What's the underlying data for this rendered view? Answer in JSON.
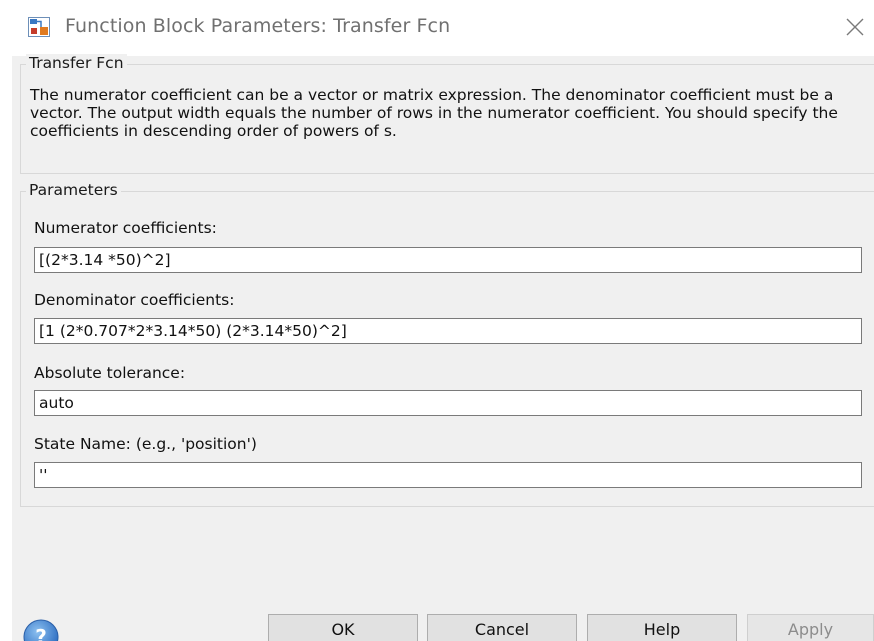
{
  "window": {
    "title": "Function Block Parameters: Transfer Fcn"
  },
  "block": {
    "name": "Transfer Fcn",
    "description": "The numerator coefficient can be a vector or matrix expression. The denominator coefficient must be a vector. The output width equals the number of rows in the numerator coefficient. You should specify the coefficients in descending order of powers of s."
  },
  "parameters": {
    "section_label": "Parameters",
    "numerator": {
      "label": "Numerator coefficients:",
      "value": "[(2*3.14 *50)^2]"
    },
    "denominator": {
      "label": "Denominator coefficients:",
      "value": "[1 (2*0.707*2*3.14*50) (2*3.14*50)^2]"
    },
    "abs_tolerance": {
      "label": "Absolute tolerance:",
      "value": "auto"
    },
    "state_name": {
      "label": "State Name: (e.g., 'position')",
      "value": "''"
    }
  },
  "buttons": {
    "ok": "OK",
    "cancel": "Cancel",
    "help": "Help",
    "apply": "Apply"
  },
  "icons": {
    "app": "simulink-block-icon",
    "close": "close-icon",
    "help": "question-icon"
  },
  "colors": {
    "dialog_bg": "#f0f0f0",
    "titlebar_bg": "#ffffff",
    "help_icon_blue": "#3b7fd0"
  }
}
